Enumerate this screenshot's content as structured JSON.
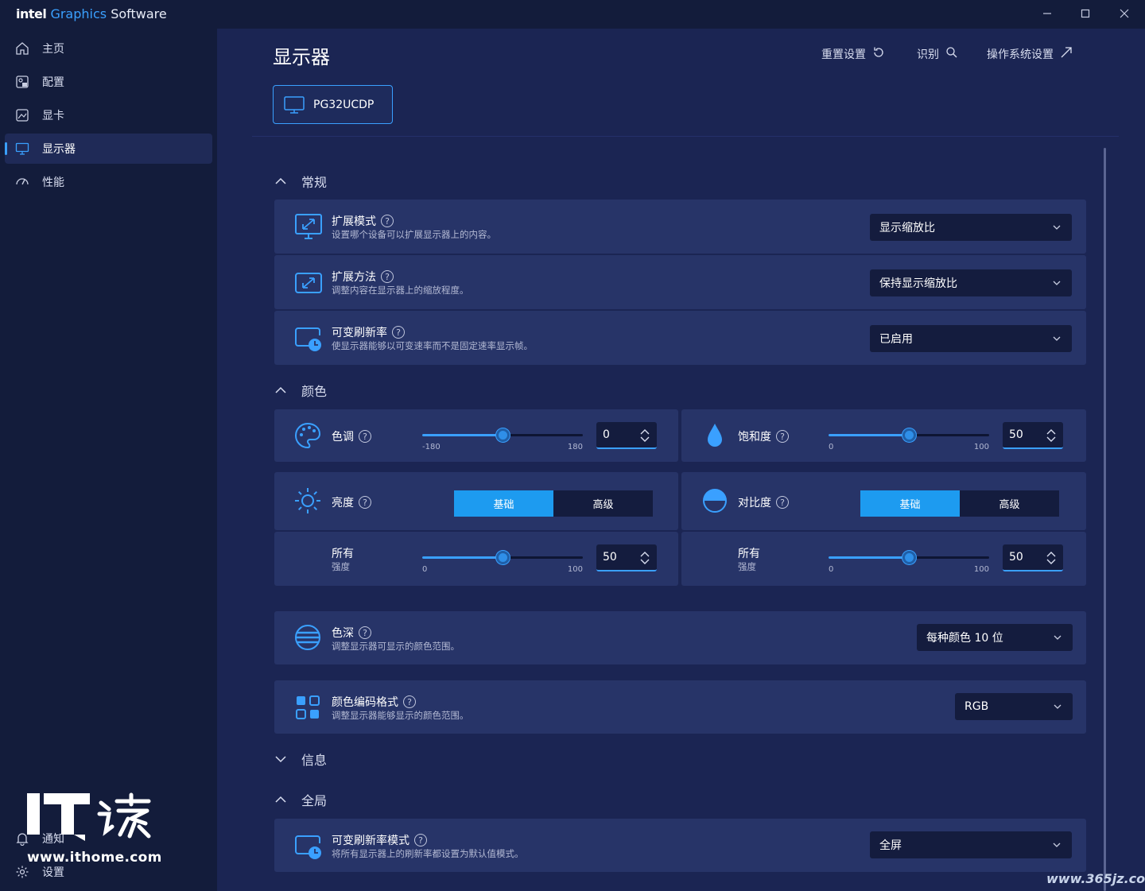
{
  "titlebar": {
    "brand_intel": "intel",
    "brand_graphics": "Graphics",
    "brand_software": "Software",
    "minimize": "—",
    "maximize": "☐",
    "close": "✕"
  },
  "sidebar": {
    "items": [
      {
        "label": "主页",
        "icon": "home-icon"
      },
      {
        "label": "配置",
        "icon": "profile-icon"
      },
      {
        "label": "显卡",
        "icon": "graphics-card-icon"
      },
      {
        "label": "显示器",
        "icon": "monitor-icon",
        "active": true
      },
      {
        "label": "性能",
        "icon": "performance-icon"
      }
    ],
    "bottom": [
      {
        "label": "通知",
        "icon": "bell-icon"
      },
      {
        "label": "设置",
        "icon": "gear-icon"
      }
    ]
  },
  "header": {
    "title": "显示器",
    "actions": {
      "reset": "重置设置",
      "identify": "识别",
      "os_settings": "操作系统设置"
    },
    "monitor_tab": "PG32UCDP"
  },
  "sections": {
    "general": "常规",
    "color": "颜色",
    "info": "信息",
    "global": "全局"
  },
  "general": {
    "scaling_mode": {
      "title": "扩展模式",
      "desc": "设置哪个设备可以扩展显示器上的内容。",
      "value": "显示缩放比"
    },
    "scaling_method": {
      "title": "扩展方法",
      "desc": "调整内容在显示器上的缩放程度。",
      "value": "保持显示缩放比"
    },
    "vrr": {
      "title": "可变刷新率",
      "desc": "使显示器能够以可变速率而不是固定速率显示帧。",
      "value": "已启用"
    }
  },
  "color": {
    "hue": {
      "title": "色调",
      "min": "-180",
      "max": "180",
      "value": "0",
      "level": 0.5
    },
    "saturation": {
      "title": "饱和度",
      "min": "0",
      "max": "100",
      "value": "50",
      "level": 0.5
    },
    "brightness": {
      "title": "亮度",
      "seg_basic": "基础",
      "seg_advanced": "高级",
      "channel": "所有",
      "channel_sub": "强度",
      "min": "0",
      "max": "100",
      "value": "50",
      "level": 0.5
    },
    "contrast": {
      "title": "对比度",
      "seg_basic": "基础",
      "seg_advanced": "高级",
      "channel": "所有",
      "channel_sub": "强度",
      "min": "0",
      "max": "100",
      "value": "50",
      "level": 0.5
    },
    "depth": {
      "title": "色深",
      "desc": "调整显示器可显示的颜色范围。",
      "value": "每种颜色 10 位"
    },
    "encoding": {
      "title": "颜色编码格式",
      "desc": "调整显示器能够显示的颜色范围。",
      "value": "RGB"
    }
  },
  "global": {
    "vrr_mode": {
      "title": "可变刷新率模式",
      "desc": "将所有显示器上的刷新率都设置为默认值模式。",
      "value": "全屏"
    }
  },
  "watermark": {
    "logo_text": "IT之家",
    "url": "www.ithome.com",
    "corner": "www.365jz.com"
  }
}
